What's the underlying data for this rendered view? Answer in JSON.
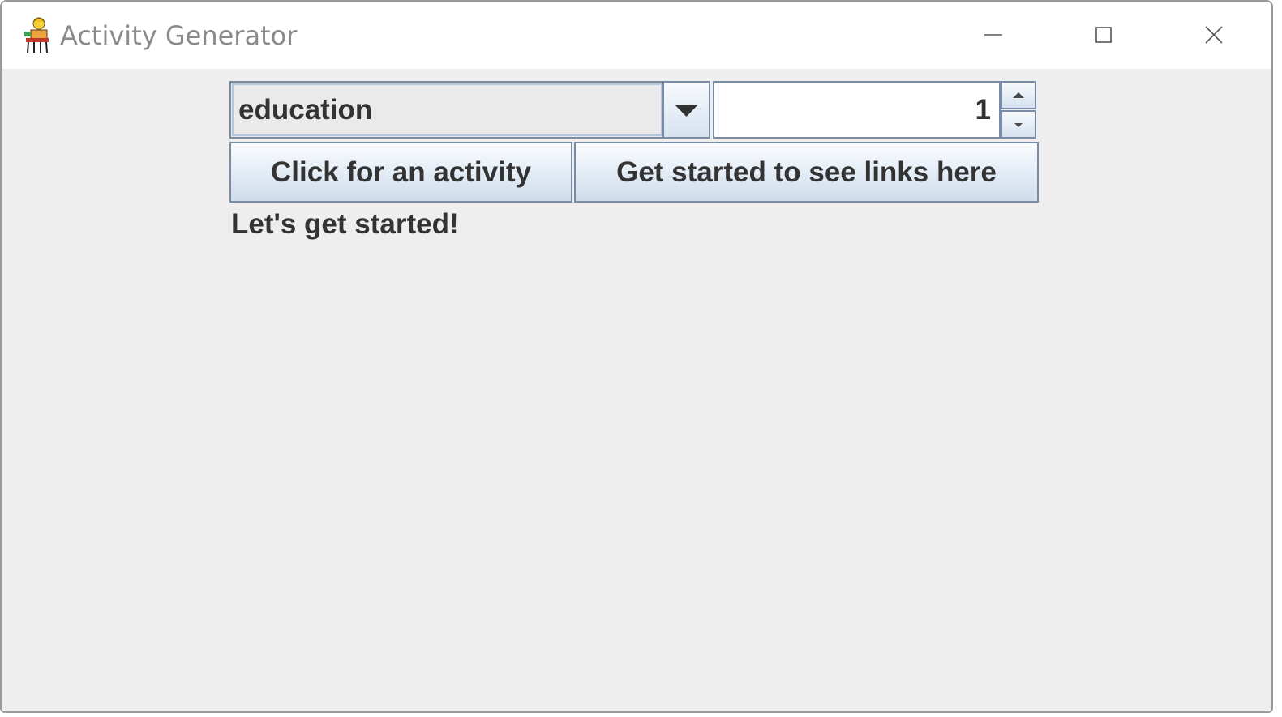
{
  "window": {
    "title": "Activity Generator",
    "icons": {
      "app": "activity-generator-app-icon",
      "minimize": "minimize-icon",
      "maximize": "maximize-icon",
      "close": "close-icon"
    }
  },
  "controls": {
    "category_select": {
      "value": "education",
      "arrow_icon": "chevron-down-icon"
    },
    "participants_spinner": {
      "value": "1",
      "up_icon": "arrow-up-icon",
      "down_icon": "arrow-down-icon"
    },
    "activity_button_label": "Click for an activity",
    "links_button_label": "Get started to see links here"
  },
  "status": {
    "message": "Let's get started!"
  },
  "colors": {
    "background": "#eeeeee",
    "border": "#7a8ba5",
    "text": "#333333",
    "title_text": "#8a8a8a"
  }
}
